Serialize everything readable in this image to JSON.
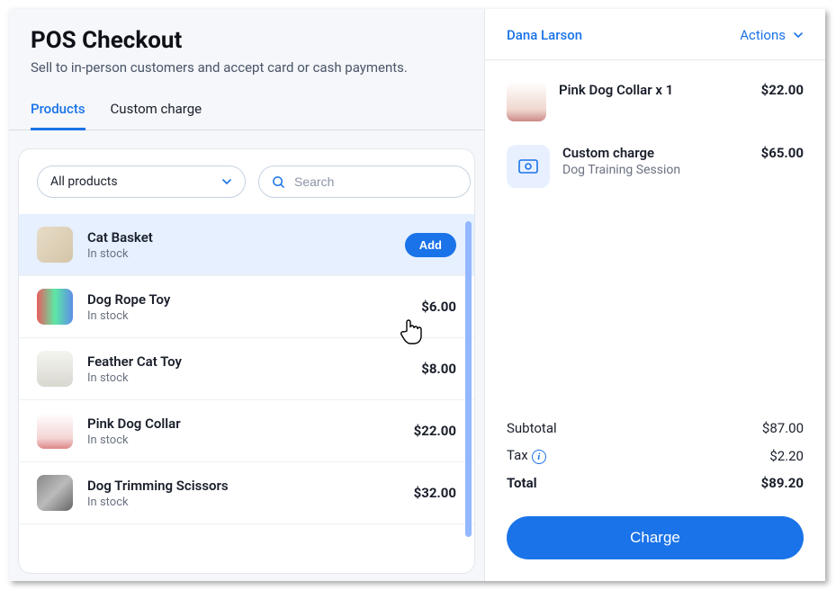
{
  "header": {
    "title": "POS Checkout",
    "subtitle": "Sell to in-person customers and accept card or cash payments."
  },
  "tabs": {
    "products": "Products",
    "custom_charge": "Custom charge"
  },
  "filters": {
    "all_products": "All products",
    "search_placeholder": "Search"
  },
  "products": [
    {
      "name": "Cat Basket",
      "stock": "In stock",
      "price": "",
      "add_label": "Add",
      "thumb": "basket",
      "hovered": true
    },
    {
      "name": "Dog Rope Toy",
      "stock": "In stock",
      "price": "$6.00",
      "thumb": "rope"
    },
    {
      "name": "Feather Cat Toy",
      "stock": "In stock",
      "price": "$8.00",
      "thumb": "feather"
    },
    {
      "name": "Pink Dog Collar",
      "stock": "In stock",
      "price": "$22.00",
      "thumb": "collar"
    },
    {
      "name": "Dog Trimming Scissors",
      "stock": "In stock",
      "price": "$32.00",
      "thumb": "scissors"
    }
  ],
  "customer": {
    "name": "Dana Larson",
    "actions_label": "Actions"
  },
  "cart": [
    {
      "title": "Pink Dog Collar x 1",
      "sub": "",
      "price": "$22.00",
      "thumb": "dog"
    },
    {
      "title": "Custom charge",
      "sub": "Dog Training Session",
      "price": "$65.00",
      "thumb": "custom"
    }
  ],
  "totals": {
    "subtotal_label": "Subtotal",
    "subtotal_value": "$87.00",
    "tax_label": "Tax",
    "tax_value": "$2.20",
    "total_label": "Total",
    "total_value": "$89.20"
  },
  "charge_button": "Charge",
  "colors": {
    "primary": "#1a73e8"
  }
}
